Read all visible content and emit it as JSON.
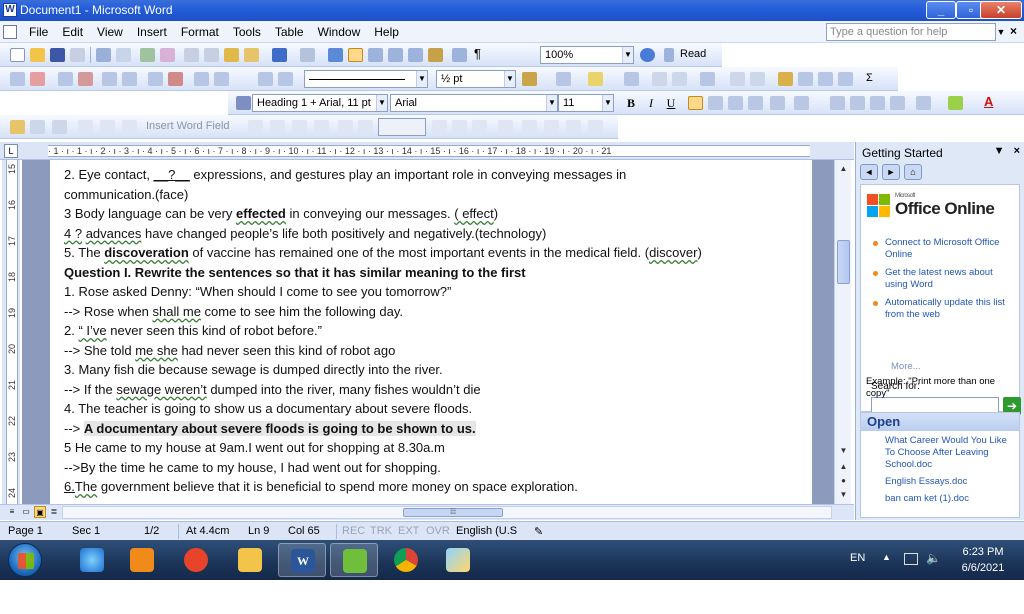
{
  "window": {
    "title": "Document1 - Microsoft Word",
    "minimize": "_",
    "maximize": "▫",
    "close": "✕"
  },
  "menu": {
    "items": [
      "File",
      "Edit",
      "View",
      "Insert",
      "Format",
      "Tools",
      "Table",
      "Window",
      "Help"
    ],
    "help_placeholder": "Type a question for help",
    "close_glyph": "×"
  },
  "toolbar": {
    "zoom": "100%",
    "read_label": "Read",
    "line_weight": "½ pt",
    "style": "Heading 1 + Arial, 11 pt",
    "font": "Arial",
    "size": "11",
    "bold": "B",
    "italic": "I",
    "underline": "U",
    "insert_word_field": "Insert Word Field"
  },
  "ruler": {
    "corner": "L",
    "h_marks": "· 1 · ı · 1 · ı · 2 · ı · 3 · ı · 4 · ı · 5 · ı · 6 · ı · 7 · ı · 8 · ı · 9 · ı · 10 · ı · 11 · ı · 12 · ı · 13 · ı · 14 · ı · 15 · ı · 16 · ı · 17 · ı · 18 · ı · 19 · ı · 20 · ı · 21",
    "v_marks": [
      "15",
      "16",
      "17",
      "18",
      "19",
      "20",
      "21",
      "22",
      "23",
      "24"
    ]
  },
  "document": {
    "lines": [
      {
        "parts": [
          {
            "t": "2. Eye contact, "
          },
          {
            "t": "__?__",
            "c": "uline"
          },
          {
            "t": " expressions, and gestures play an important role in conveying messages in"
          }
        ]
      },
      {
        "parts": [
          {
            "t": "communication.(face)"
          }
        ]
      },
      {
        "parts": [
          {
            "t": "3 Body language can be very "
          },
          {
            "t": "effected",
            "c": "bold squig"
          },
          {
            "t": " in conveying our messages. "
          },
          {
            "t": "( effect",
            "c": "squig"
          },
          {
            "t": ")"
          }
        ]
      },
      {
        "parts": [
          {
            "t": "4 ?",
            "c": "squig"
          },
          {
            "t": "  "
          },
          {
            "t": "advances",
            "c": "squig"
          },
          {
            "t": " have changed people’s life both positively and negatively.(technology)"
          }
        ]
      },
      {
        "parts": [
          {
            "t": "5. The "
          },
          {
            "t": "discoveration",
            "c": "bold squig"
          },
          {
            "t": " of vaccine has remained one of the most important events in the medical field. ("
          },
          {
            "t": "discover",
            "c": "squig"
          },
          {
            "t": ")"
          }
        ]
      },
      {
        "parts": [
          {
            "t": "Question I. Rewrite the sentences so that it has similar meaning to the first",
            "c": "bold"
          }
        ]
      },
      {
        "parts": [
          {
            "t": "1. Rose asked Denny: “When should I come to see you tomorrow?”"
          }
        ]
      },
      {
        "parts": [
          {
            "t": " --> Rose when "
          },
          {
            "t": "shall me",
            "c": "squig"
          },
          {
            "t": " come to see him the following day."
          }
        ]
      },
      {
        "parts": [
          {
            "t": "2. "
          },
          {
            "t": "“ I’ve",
            "c": "squig"
          },
          {
            "t": " never seen this kind of robot before.”"
          }
        ]
      },
      {
        "parts": [
          {
            "t": "--> She told "
          },
          {
            "t": "me  she",
            "c": "squig"
          },
          {
            "t": " had never seen this kind of robot ago"
          }
        ]
      },
      {
        "parts": [
          {
            "t": "3. Many fish die because sewage is dumped directly into the river."
          }
        ]
      },
      {
        "parts": [
          {
            "t": "--> If the "
          },
          {
            "t": "sewage  weren’t",
            "c": "squig"
          },
          {
            "t": " dumped into the river, many fishes wouldn’t die"
          }
        ]
      },
      {
        "parts": [
          {
            "t": "4. The teacher is going to show us a documentary about severe floods."
          }
        ]
      },
      {
        "parts": [
          {
            "t": "--> "
          },
          {
            "t": "A documentary about severe floods is going to be shown to us.",
            "c": "bold hl"
          }
        ]
      },
      {
        "parts": [
          {
            "t": "5 He came to my house at 9am.I went out for shopping at 8.30a.m"
          }
        ]
      },
      {
        "parts": [
          {
            "t": " -->By the time he came to my house, I had went out for shopping."
          }
        ]
      },
      {
        "parts": [
          {
            "t": "6.",
            "c": "uline"
          },
          {
            "t": "The",
            "c": "squig"
          },
          {
            "t": " government believe that it is beneficial to spend more money on space exploration."
          }
        ]
      }
    ]
  },
  "taskpane": {
    "title": "Getting Started",
    "logo_small": "Microsoft",
    "logo_text": "Office Online",
    "links": [
      "Connect to Microsoft Office Online",
      "Get the latest news about using Word",
      "Automatically update this list from the web"
    ],
    "more": "More...",
    "search_label": "Search for:",
    "example": "Example:  \"Print more than one copy\"",
    "open_title": "Open",
    "open_files": [
      "What Career Would You Like To Choose After Leaving School.doc",
      "English Essays.doc",
      "ban cam ket (1).doc"
    ]
  },
  "status": {
    "page": "Page  1",
    "sec": "Sec  1",
    "pages": "1/2",
    "at": "At  4.4cm",
    "ln": "Ln  9",
    "col": "Col  65",
    "rec": "REC",
    "trk": "TRK",
    "ext": "EXT",
    "ovr": "OVR",
    "lang": "English (U.S"
  },
  "taskbar": {
    "lang": "EN",
    "time": "6:23 PM",
    "date": "6/6/2021",
    "apps": [
      "internet-explorer",
      "media-player",
      "foxit",
      "explorer",
      "word",
      "app-green",
      "chrome",
      "paint"
    ]
  },
  "colors": {
    "titlebar": "#245edb",
    "accent_link": "#2355b8",
    "bullet": "#f08a1a"
  }
}
